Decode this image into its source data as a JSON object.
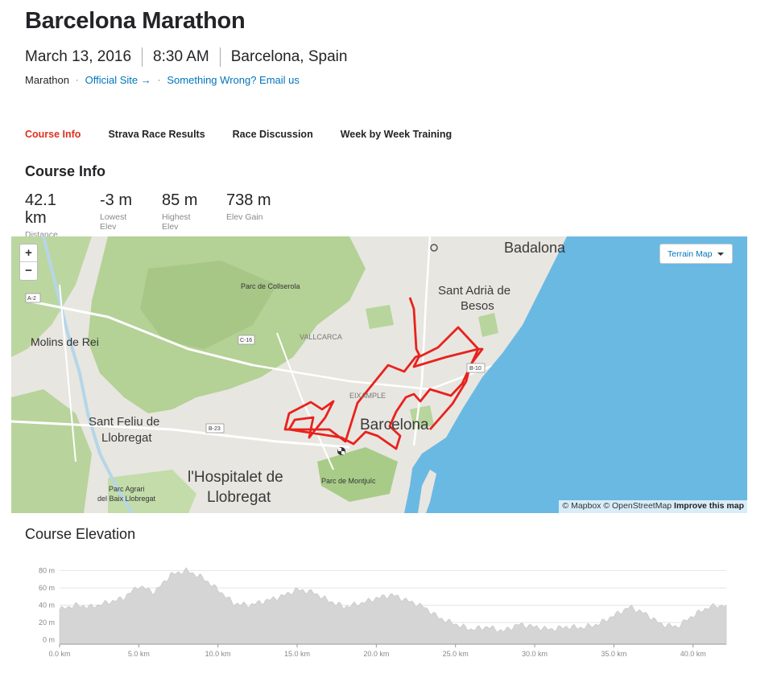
{
  "event": {
    "title": "Barcelona Marathon",
    "date": "March 13, 2016",
    "time": "8:30 AM",
    "location": "Barcelona, Spain",
    "type": "Marathon",
    "official_site": "Official Site →",
    "report": "Something Wrong? Email us"
  },
  "tabs": [
    {
      "label": "Course Info",
      "active": true
    },
    {
      "label": "Strava Race Results",
      "active": false
    },
    {
      "label": "Race Discussion",
      "active": false
    },
    {
      "label": "Week by Week Training",
      "active": false
    }
  ],
  "course_info": {
    "heading": "Course Info",
    "stats": [
      {
        "value": "42.1 km",
        "label": "Distance"
      },
      {
        "value": "-3 m",
        "label": "Lowest Elev"
      },
      {
        "value": "85 m",
        "label": "Highest Elev"
      },
      {
        "value": "738 m",
        "label": "Elev Gain"
      }
    ]
  },
  "map": {
    "zoom_in": "+",
    "zoom_out": "−",
    "style_button": "Terrain Map",
    "attribution_a": "© Mapbox © OpenStreetMap ",
    "attribution_b": "Improve this map",
    "labels": {
      "badalona": "Badalona",
      "sant_adria_1": "Sant Adrià de",
      "sant_adria_2": "Besos",
      "collserola": "Parc de Collserola",
      "molins": "Molins de Rei",
      "vallcarca": "VALLCARCA",
      "eixample": "EIXAMPLE",
      "barcelona": "Barcelona",
      "feliu_1": "Sant Feliu de",
      "feliu_2": "Llobregat",
      "hospitalet_1": "l'Hospitalet de",
      "hospitalet_2": "Llobregat",
      "montjuic": "Parc de Montjuïc",
      "agrari_1": "Parc Agrari",
      "agrari_2": "del Baix Llobregat",
      "a2": "A-2",
      "c16": "C-16",
      "b23": "B-23",
      "b10": "B-10"
    },
    "colors": {
      "water": "#6ab9e3",
      "route": "#e8221e",
      "green": "#a9cc8a",
      "land": "#e6e4de"
    }
  },
  "elevation": {
    "heading": "Course Elevation",
    "chart_data": {
      "type": "area",
      "xlabel": "",
      "ylabel": "",
      "xlim": [
        0,
        42.1
      ],
      "ylim": [
        -3,
        85
      ],
      "y_ticks": [
        "80 m",
        "60 m",
        "40 m",
        "20 m",
        "0 m"
      ],
      "y_tick_values": [
        80,
        60,
        40,
        20,
        0
      ],
      "x_ticks": [
        "0.0 km",
        "5.0 km",
        "10.0 km",
        "15.0 km",
        "20.0 km",
        "25.0 km",
        "30.0 km",
        "35.0 km",
        "40.0 km"
      ],
      "x_tick_values": [
        0,
        5,
        10,
        15,
        20,
        25,
        30,
        35,
        40
      ],
      "x": [
        0,
        1,
        2,
        3,
        4,
        5,
        6,
        7,
        8,
        9,
        10,
        11,
        12,
        13,
        14,
        15,
        16,
        17,
        18,
        19,
        20,
        21,
        22,
        23,
        24,
        25,
        26,
        27,
        28,
        29,
        30,
        31,
        32,
        33,
        34,
        35,
        36,
        37,
        38,
        39,
        40,
        41,
        42.1
      ],
      "y": [
        35,
        40,
        38,
        43,
        48,
        62,
        55,
        75,
        80,
        72,
        58,
        42,
        40,
        45,
        50,
        58,
        55,
        45,
        38,
        42,
        48,
        52,
        45,
        38,
        25,
        18,
        12,
        15,
        10,
        18,
        15,
        12,
        15,
        14,
        18,
        28,
        38,
        30,
        18,
        15,
        28,
        38,
        40
      ],
      "grid": true
    }
  }
}
